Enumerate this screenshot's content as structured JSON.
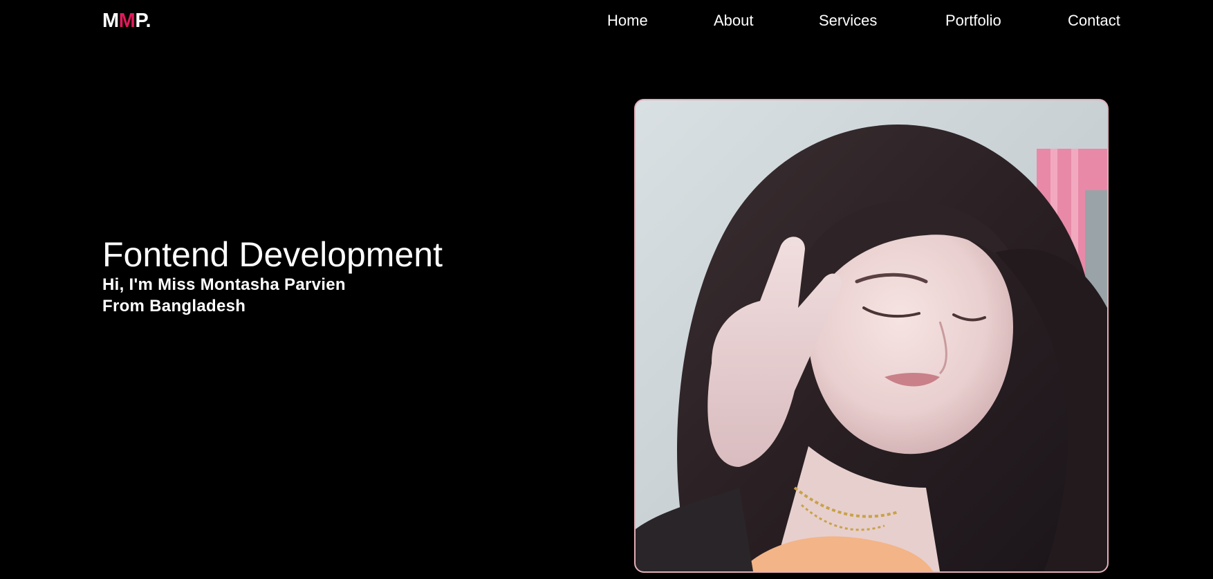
{
  "header": {
    "logo": {
      "part1": "M",
      "part2": "M",
      "part3": "P."
    },
    "nav": [
      {
        "label": "Home"
      },
      {
        "label": "About"
      },
      {
        "label": "Services"
      },
      {
        "label": "Portfolio"
      },
      {
        "label": "Contact"
      }
    ]
  },
  "hero": {
    "title": "Fontend Development",
    "greeting": "Hi, I'm Miss Montasha Parvien",
    "origin": "From Bangladesh"
  },
  "colors": {
    "background": "#000000",
    "text": "#ffffff",
    "accent": "#e0195a",
    "photo_border": "#e4aeb8"
  }
}
